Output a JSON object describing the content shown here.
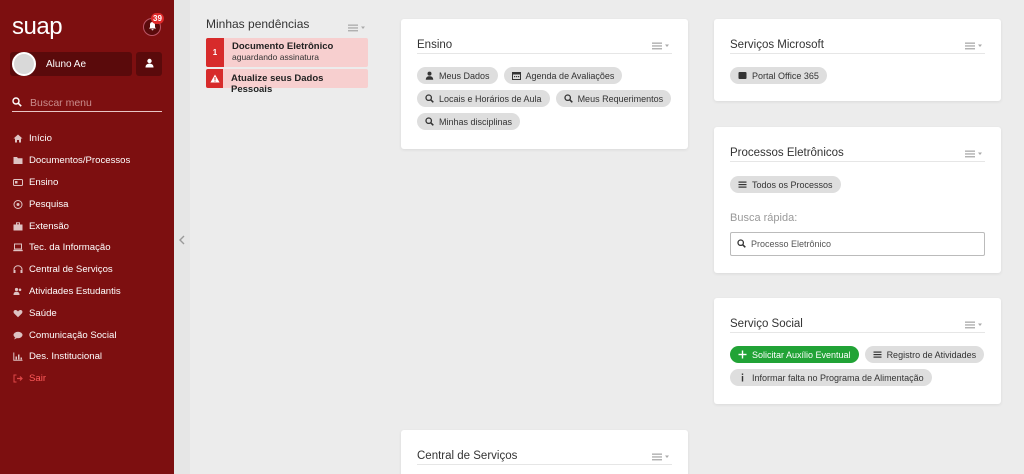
{
  "sidebar": {
    "logo": "suap",
    "notifications_count": "39",
    "user_name": "Aluno Ae",
    "search_placeholder": "Buscar menu",
    "items": [
      {
        "label": "Início",
        "icon": "home-icon"
      },
      {
        "label": "Documentos/Processos",
        "icon": "folder-icon"
      },
      {
        "label": "Ensino",
        "icon": "id-card-icon"
      },
      {
        "label": "Pesquisa",
        "icon": "microscope-icon"
      },
      {
        "label": "Extensão",
        "icon": "briefcase-icon"
      },
      {
        "label": "Tec. da Informação",
        "icon": "laptop-icon"
      },
      {
        "label": "Central de Serviços",
        "icon": "headset-icon"
      },
      {
        "label": "Atividades Estudantis",
        "icon": "users-icon"
      },
      {
        "label": "Saúde",
        "icon": "heartbeat-icon"
      },
      {
        "label": "Comunicação Social",
        "icon": "comments-icon"
      },
      {
        "label": "Des. Institucional",
        "icon": "chart-icon"
      },
      {
        "label": "Sair",
        "icon": "sign-out-icon"
      }
    ]
  },
  "pendencias": {
    "title": "Minhas pendências",
    "items": [
      {
        "mark": "1",
        "label": "Documento Eletrônico",
        "sub": "aguardando assinatura"
      },
      {
        "mark": "!",
        "label": "Atualize seus Dados Pessoais",
        "sub": ""
      }
    ]
  },
  "ensino": {
    "title": "Ensino",
    "links": [
      {
        "label": "Meus Dados",
        "icon": "user-icon"
      },
      {
        "label": "Agenda de Avaliações",
        "icon": "calendar-icon"
      },
      {
        "label": "Locais e Horários de Aula",
        "icon": "search-icon"
      },
      {
        "label": "Meus Requerimentos",
        "icon": "search-icon"
      },
      {
        "label": "Minhas disciplinas",
        "icon": "search-icon"
      }
    ]
  },
  "central": {
    "title": "Central de Serviços"
  },
  "microsoft": {
    "title": "Serviços Microsoft",
    "links": [
      {
        "label": "Portal Office 365",
        "icon": "windows-icon"
      }
    ]
  },
  "processos": {
    "title": "Processos Eletrônicos",
    "links": [
      {
        "label": "Todos os Processos",
        "icon": "list-icon"
      }
    ],
    "busca_label": "Busca rápida:",
    "busca_placeholder": "Processo Eletrônico"
  },
  "social": {
    "title": "Serviço Social",
    "links": [
      {
        "label": "Solicitar Auxílio Eventual",
        "icon": "plus-icon",
        "variant": "green"
      },
      {
        "label": "Registro de Atividades",
        "icon": "list-icon"
      },
      {
        "label": "Informar falta no Programa de Alimentação",
        "icon": "info-icon"
      }
    ]
  },
  "colors": {
    "sidebar_bg": "#7d0f10",
    "accent_red": "#d72b2b",
    "success_green": "#21a336",
    "page_bg": "#ececec"
  }
}
